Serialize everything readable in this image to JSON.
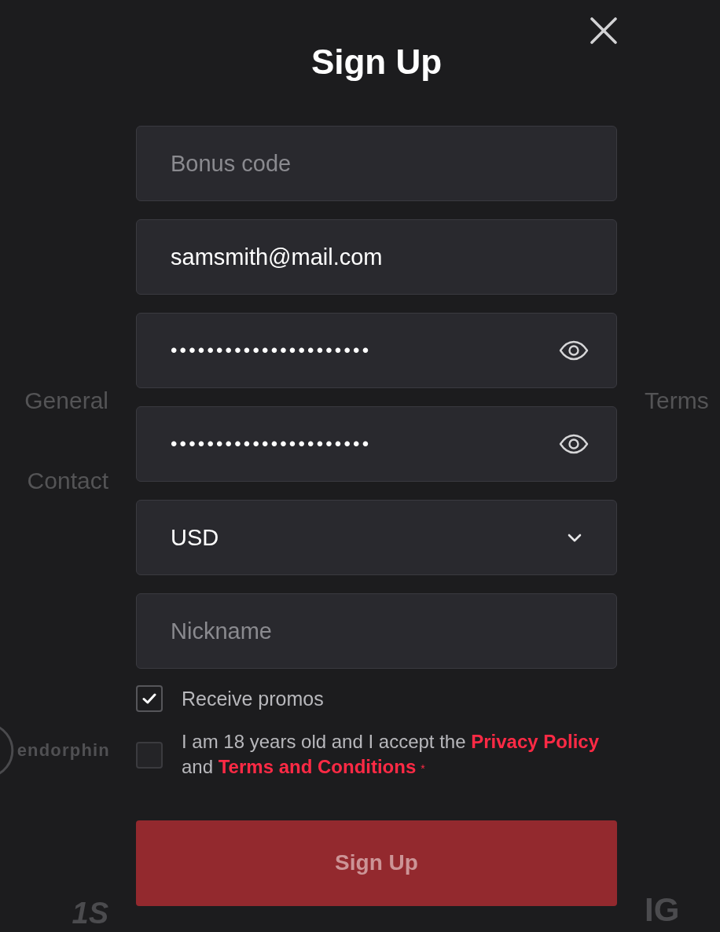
{
  "background_page": {
    "left": [
      {
        "kind": "link",
        "text": "General"
      },
      {
        "kind": "link",
        "text": "Contact"
      },
      {
        "kind": "ring_logo",
        "text": "endorphin"
      },
      {
        "kind": "block_logo",
        "text": "1S"
      }
    ],
    "right": [
      {
        "kind": "link",
        "text": "Terms"
      },
      {
        "kind": "block_logo",
        "text": "IG"
      }
    ]
  },
  "dialog": {
    "title": "Sign Up"
  },
  "fields": [
    {
      "kind": "text",
      "placeholder": "Bonus code"
    },
    {
      "kind": "text",
      "value": "samsmith@mail.com"
    },
    {
      "kind": "password",
      "value": "••••••••••••••••••••••"
    },
    {
      "kind": "password",
      "value": "••••••••••••••••••••••"
    },
    {
      "kind": "select",
      "value": "USD"
    },
    {
      "kind": "text",
      "placeholder": "Nickname"
    }
  ],
  "agreements": [
    {
      "kind": "plain",
      "checked": true,
      "label": "Receive promos"
    },
    {
      "kind": "consent",
      "checked": false,
      "segments": [
        {
          "kind": "text",
          "text": "I am 18 years old and I accept the "
        },
        {
          "kind": "link",
          "text": "Privacy Policy"
        },
        {
          "kind": "text",
          "text": " and "
        },
        {
          "kind": "link",
          "text": "Terms and Conditions"
        }
      ],
      "required_mark": "*"
    }
  ],
  "submit": {
    "label": "Sign Up",
    "disabled": true
  }
}
